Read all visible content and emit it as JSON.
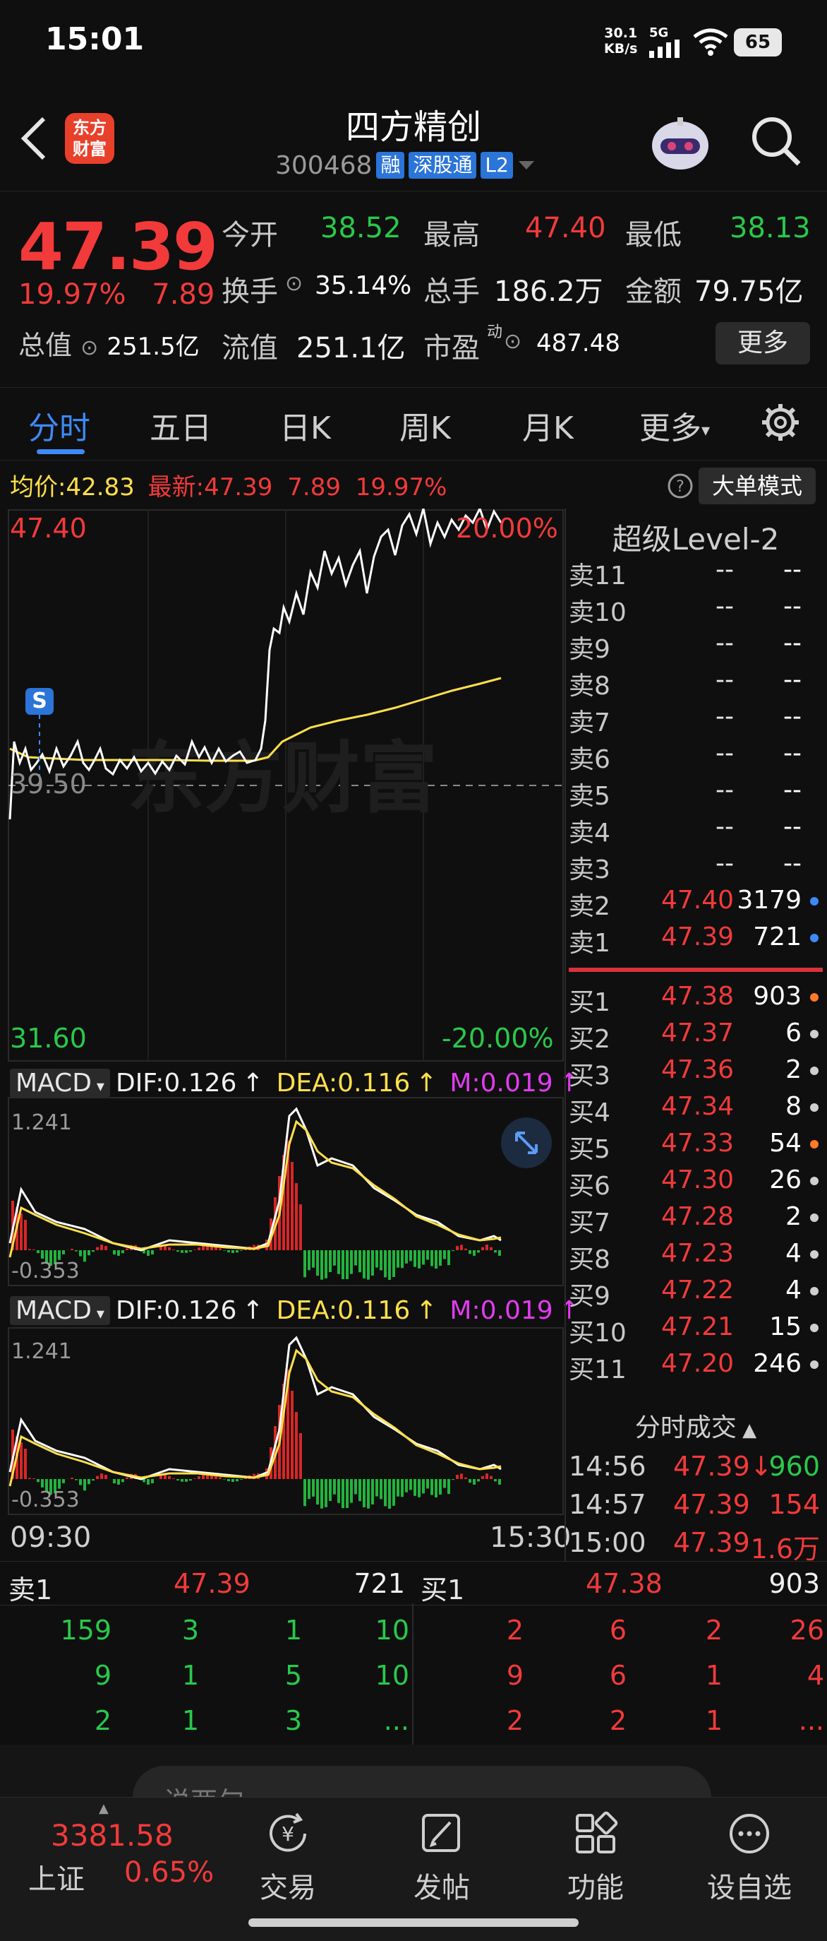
{
  "status": {
    "time": "15:01",
    "net_speed_value": "30.1",
    "net_speed_unit": "KB/s",
    "network": "5G",
    "battery": "65"
  },
  "header": {
    "logo_line1": "东方",
    "logo_line2": "财富",
    "stock_name": "四方精创",
    "stock_code": "300468",
    "tags": [
      "融",
      "深股通",
      "L2"
    ]
  },
  "quote": {
    "price": "47.39",
    "change_pct": "19.97%",
    "change": "7.89",
    "open_label": "今开",
    "open": "38.52",
    "high_label": "最高",
    "high": "47.40",
    "low_label": "最低",
    "low": "38.13",
    "turnover_label": "换手",
    "turnover": "35.14%",
    "volume_label": "总手",
    "volume": "186.2万",
    "amount_label": "金额",
    "amount": "79.75亿",
    "mktcap_label": "总值",
    "mktcap": "251.5亿",
    "float_label": "流值",
    "float": "251.1亿",
    "pe_label": "市盈",
    "pe_sup": "动",
    "pe": "487.48",
    "more": "更多"
  },
  "tabs": [
    "分时",
    "五日",
    "日K",
    "周K",
    "月K",
    "更多"
  ],
  "info": {
    "avg_label": "均价:",
    "avg": "42.83",
    "latest_label": "最新:",
    "latest": "47.39",
    "latest_change": "7.89",
    "latest_pct": "19.97%",
    "big_order": "大单模式"
  },
  "chart": {
    "y_max": "47.40",
    "y_mid": "39.50",
    "y_min": "31.60",
    "pct_max": "20.00%",
    "pct_min": "-20.00%",
    "signal": "S",
    "watermark": "东方财富",
    "time_start": "09:30",
    "time_end": "15:30"
  },
  "macd": {
    "label": "MACD",
    "dif": "DIF:0.126",
    "dea": "DEA:0.116",
    "m": "M:0.019",
    "arrow": "↑",
    "top": "1.241",
    "bottom": "-0.353"
  },
  "orderbook": {
    "title": "超级Level-2",
    "asks": [
      {
        "label": "卖11",
        "price": "--",
        "vol": "--"
      },
      {
        "label": "卖10",
        "price": "--",
        "vol": "--"
      },
      {
        "label": "卖9",
        "price": "--",
        "vol": "--"
      },
      {
        "label": "卖8",
        "price": "--",
        "vol": "--"
      },
      {
        "label": "卖7",
        "price": "--",
        "vol": "--"
      },
      {
        "label": "卖6",
        "price": "--",
        "vol": "--"
      },
      {
        "label": "卖5",
        "price": "--",
        "vol": "--"
      },
      {
        "label": "卖4",
        "price": "--",
        "vol": "--"
      },
      {
        "label": "卖3",
        "price": "--",
        "vol": "--"
      },
      {
        "label": "卖2",
        "price": "47.40",
        "vol": "3179",
        "dot": "#3d8af7"
      },
      {
        "label": "卖1",
        "price": "47.39",
        "vol": "721",
        "dot": "#3d8af7"
      }
    ],
    "bids": [
      {
        "label": "买1",
        "price": "47.38",
        "vol": "903",
        "dot": "#ff7a29"
      },
      {
        "label": "买2",
        "price": "47.37",
        "vol": "6",
        "dot": "#cfcfcf"
      },
      {
        "label": "买3",
        "price": "47.36",
        "vol": "2",
        "dot": "#cfcfcf"
      },
      {
        "label": "买4",
        "price": "47.34",
        "vol": "8",
        "dot": "#cfcfcf"
      },
      {
        "label": "买5",
        "price": "47.33",
        "vol": "54",
        "dot": "#ff7a29"
      },
      {
        "label": "买6",
        "price": "47.30",
        "vol": "26",
        "dot": "#cfcfcf"
      },
      {
        "label": "买7",
        "price": "47.28",
        "vol": "2",
        "dot": "#cfcfcf"
      },
      {
        "label": "买8",
        "price": "47.23",
        "vol": "4",
        "dot": "#cfcfcf"
      },
      {
        "label": "买9",
        "price": "47.22",
        "vol": "4",
        "dot": "#cfcfcf"
      },
      {
        "label": "买10",
        "price": "47.21",
        "vol": "15",
        "dot": "#cfcfcf"
      },
      {
        "label": "买11",
        "price": "47.20",
        "vol": "246",
        "dot": "#cfcfcf"
      }
    ]
  },
  "ticks": {
    "title": "分时成交",
    "rows": [
      {
        "time": "14:56",
        "price": "47.39↓",
        "vol": "960",
        "color": "#29c94a"
      },
      {
        "time": "14:57",
        "price": "47.39",
        "vol": "154",
        "color": "#f23a3a"
      },
      {
        "time": "15:00",
        "price": "47.39",
        "vol": "1.6万",
        "color": "#f23a3a"
      }
    ]
  },
  "depth": {
    "sell_label": "卖1",
    "sell_price": "47.39",
    "sell_vol": "721",
    "buy_label": "买1",
    "buy_price": "47.38",
    "buy_vol": "903",
    "sell_grid": [
      [
        "159",
        "3",
        "1",
        "10"
      ],
      [
        "9",
        "1",
        "5",
        "10"
      ],
      [
        "2",
        "1",
        "3",
        "..."
      ]
    ],
    "buy_grid": [
      [
        "2",
        "6",
        "2",
        "26"
      ],
      [
        "9",
        "6",
        "1",
        "4"
      ],
      [
        "2",
        "2",
        "1",
        "..."
      ]
    ]
  },
  "comment": {
    "placeholder": "说两句"
  },
  "bottom": {
    "index_val": "3381.58",
    "index_name": "上证",
    "index_pct": "0.65%",
    "nav": [
      "交易",
      "发帖",
      "功能",
      "设自选"
    ]
  },
  "colors": {
    "up": "#f23a3a",
    "down": "#29c94a",
    "accent": "#3d8af7",
    "avg_line": "#ffe04a"
  }
}
